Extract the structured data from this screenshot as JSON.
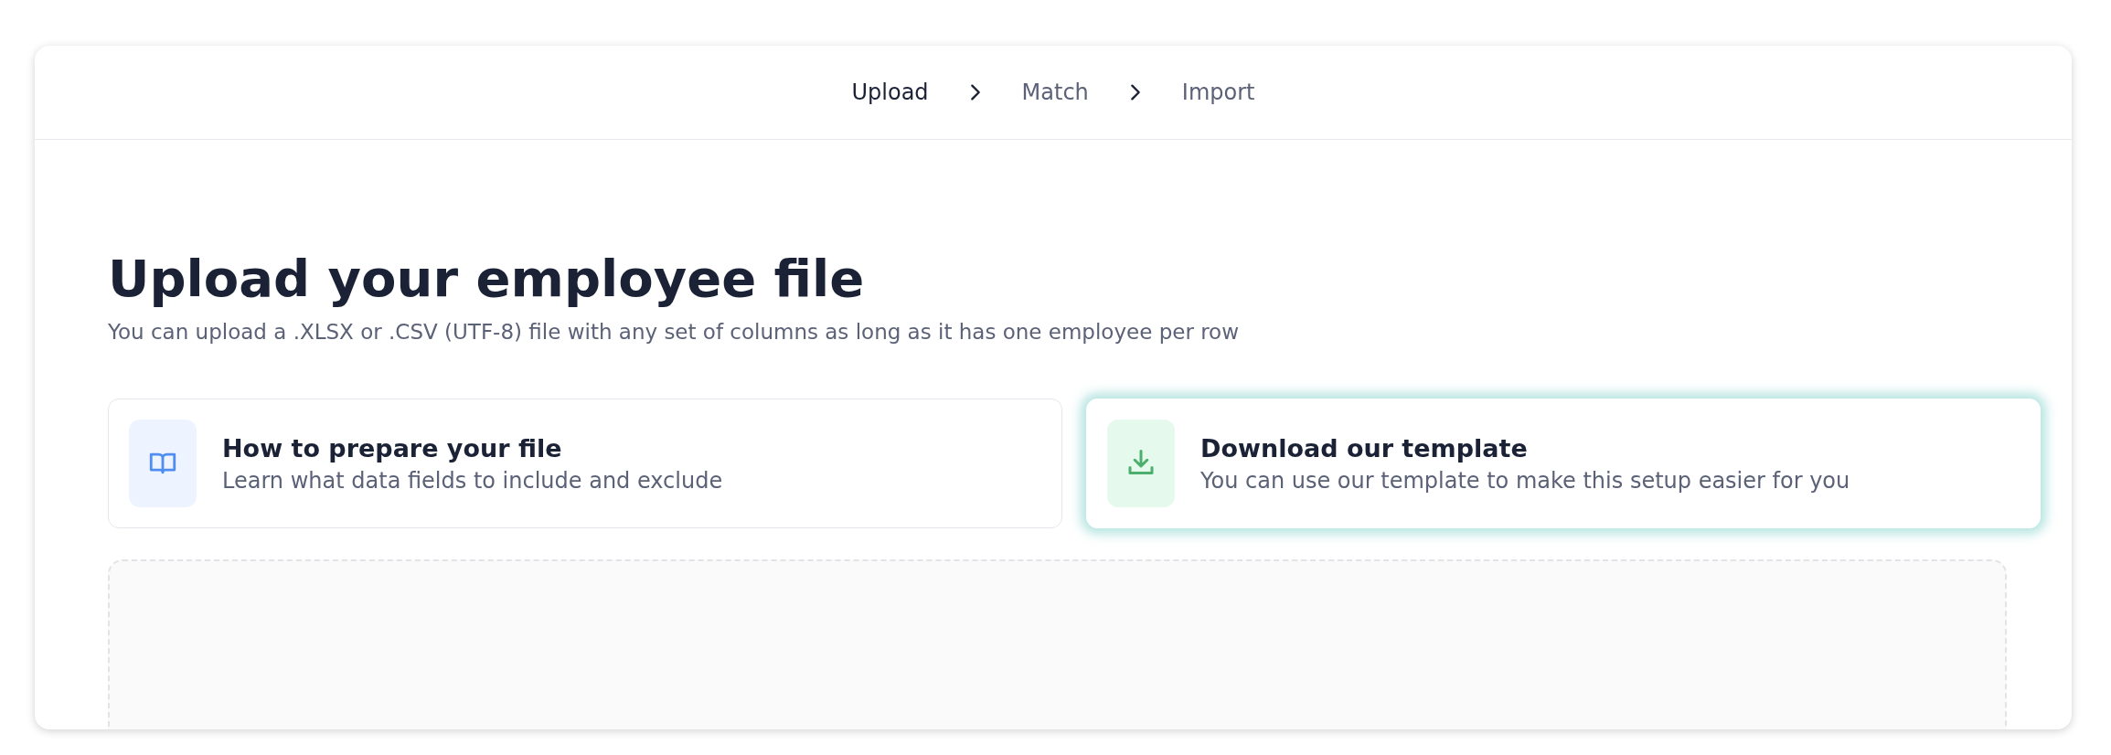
{
  "stepper": [
    {
      "label": "Upload",
      "selected": true
    },
    {
      "label": "Match",
      "selected": false
    },
    {
      "label": "Import",
      "selected": false
    }
  ],
  "title": "Upload your employee file",
  "subtitle": "You can upload a .XLSX or .CSV (UTF-8) file with any set of columns as long as it has one employee per row",
  "options": [
    {
      "kind": "guide",
      "title": "How to prepare your file",
      "description": "Learn what data fields to include and exclude",
      "selected": false
    },
    {
      "kind": "download",
      "title": "Download our template",
      "description": "You can use our template to make this setup easier for you",
      "selected": true
    }
  ]
}
